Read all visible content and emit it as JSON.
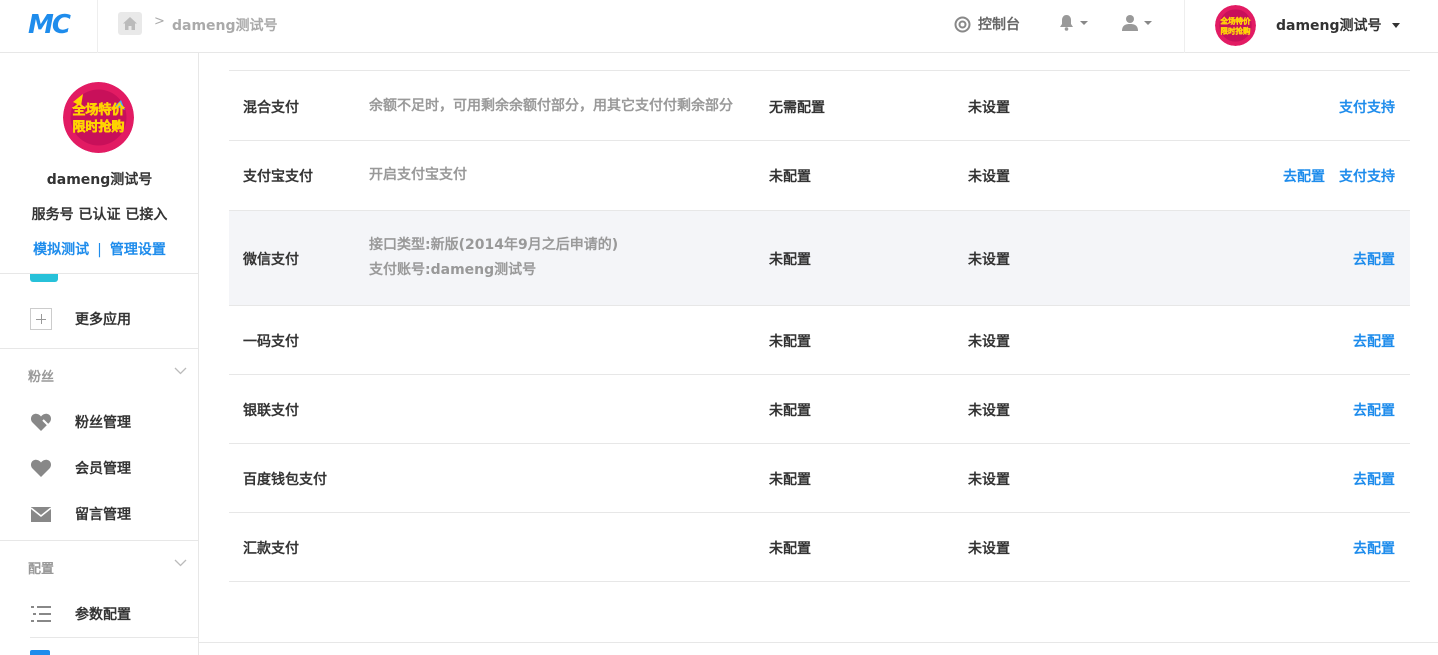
{
  "header": {
    "logo": "MC",
    "breadcrumb": "dameng测试号",
    "console_label": "控制台",
    "account_name": "dameng测试号"
  },
  "avatar_text": [
    "全场特价",
    "限时抢购"
  ],
  "sidebar": {
    "name": "dameng测试号",
    "status": "服务号 已认证 已接入",
    "link_test": "模拟测试",
    "link_separator": "|",
    "link_manage": "管理设置",
    "more_apps": "更多应用",
    "group_fans": "粉丝",
    "fans_items": [
      "粉丝管理",
      "会员管理",
      "留言管理"
    ],
    "group_config": "配置",
    "config_items": [
      "参数配置"
    ]
  },
  "payments": [
    {
      "name": "混合支付",
      "desc": [
        "余额不足时，可用剩余余额付部分，用其它支付付剩余部分"
      ],
      "config": "无需配置",
      "setting": "未设置",
      "actions": [
        "支付支持"
      ]
    },
    {
      "name": "支付宝支付",
      "desc": [
        "开启支付宝支付"
      ],
      "config": "未配置",
      "setting": "未设置",
      "actions": [
        "去配置",
        "支付支持"
      ]
    },
    {
      "name": "微信支付",
      "desc": [
        "接口类型:新版(2014年9月之后申请的)",
        "支付账号:dameng测试号"
      ],
      "config": "未配置",
      "setting": "未设置",
      "actions": [
        "去配置"
      ]
    },
    {
      "name": "一码支付",
      "desc": [],
      "config": "未配置",
      "setting": "未设置",
      "actions": [
        "去配置"
      ]
    },
    {
      "name": "银联支付",
      "desc": [],
      "config": "未配置",
      "setting": "未设置",
      "actions": [
        "去配置"
      ]
    },
    {
      "name": "百度钱包支付",
      "desc": [],
      "config": "未配置",
      "setting": "未设置",
      "actions": [
        "去配置"
      ]
    },
    {
      "name": "汇款支付",
      "desc": [],
      "config": "未配置",
      "setting": "未设置",
      "actions": [
        "去配置"
      ]
    }
  ],
  "colors": {
    "accent": "#1e8cec",
    "muted": "#999999",
    "highlight_row": "#f4f5f8"
  }
}
